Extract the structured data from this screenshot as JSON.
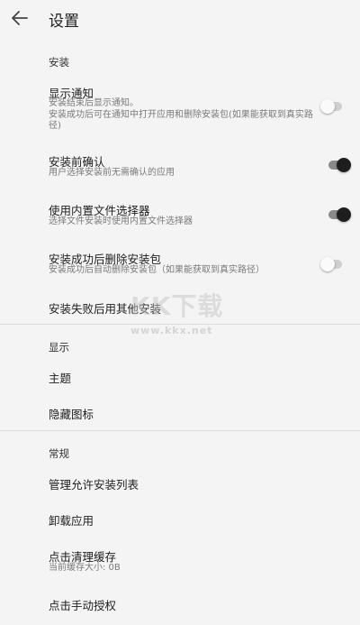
{
  "appbar": {
    "title": "设置",
    "back_icon": "arrow-left-icon"
  },
  "sections": {
    "install": {
      "header": "安装",
      "show_notification": {
        "title": "显示通知",
        "subtitle": "安装结束后显示通知。\n安装成功后可在通知中打开应用和删除安装包(如果能获取到真实路径)",
        "enabled": false
      },
      "confirm_before_install": {
        "title": "安装前确认",
        "subtitle": "用户选择安装前无需确认的应用",
        "enabled": true
      },
      "builtin_file_picker": {
        "title": "使用内置文件选择器",
        "subtitle": "选择文件安装时使用内置文件选择器",
        "enabled": true
      },
      "delete_after_install": {
        "title": "安装成功后删除安装包",
        "subtitle": "安装成功后自动删除安装包（如果能获取到真实路径）",
        "enabled": false
      },
      "fallback_installer": {
        "title": "安装失败后用其他安装"
      }
    },
    "display": {
      "header": "显示",
      "theme": {
        "title": "主题"
      },
      "hide_icon": {
        "title": "隐藏图标"
      }
    },
    "general": {
      "header": "常规",
      "allowed_list": {
        "title": "管理允许安装列表"
      },
      "uninstall": {
        "title": "卸载应用"
      },
      "clear_cache": {
        "title": "点击清理缓存",
        "subtitle": "当前缓存大小:  0B"
      },
      "manual_auth": {
        "title": "点击手动授权"
      }
    }
  },
  "watermark": {
    "logo": "KK下载",
    "url": "www.kkx.net"
  },
  "colors": {
    "background": "#f4f4f4",
    "text_primary": "#202020",
    "text_secondary": "#7a7a7a",
    "switch_on_thumb": "#1e1e1e",
    "switch_on_track": "#8a8a8a",
    "switch_off_thumb": "#fafafa",
    "switch_off_track": "#cfcfcf"
  }
}
